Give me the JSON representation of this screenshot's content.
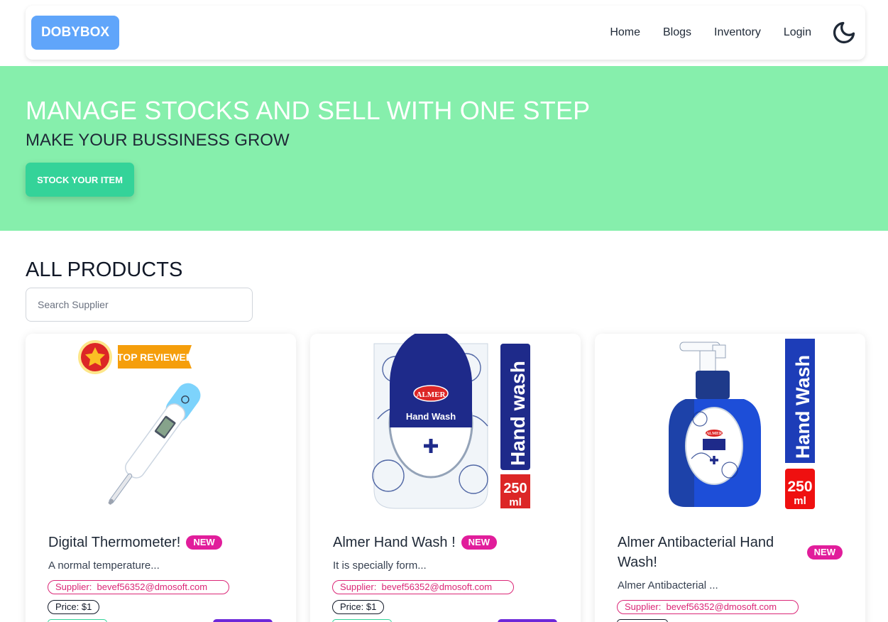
{
  "navbar": {
    "brand": "DOBYBOX",
    "links": [
      "Home",
      "Blogs",
      "Inventory",
      "Login"
    ],
    "theme_icon": "moon-icon"
  },
  "hero": {
    "headline": "MANAGE STOCKS AND SELL WITH ONE STEP",
    "subheadline": "MAKE YOUR BUSSINESS GROW",
    "cta_label": "STOCK YOUR ITEM"
  },
  "products": {
    "title": "ALL PRODUCTS",
    "search_placeholder": "Search Supplier",
    "items": [
      {
        "name": "Digital Thermometer!",
        "badge": "NEW",
        "description": "A normal temperature...",
        "supplier_label": "Supplier:",
        "supplier_email": "bevef56352@dmosoft.com",
        "price": "Price: $1",
        "ribbon": "TOP REVIEWED"
      },
      {
        "name": "Almer Hand Wash !",
        "badge": "NEW",
        "description": "It is specially form...",
        "supplier_label": "Supplier:",
        "supplier_email": "bevef56352@dmosoft.com",
        "price": "Price: $1",
        "pack_label": "Hand wash",
        "pack_brand": "ALMER",
        "pack_product": "Hand Wash",
        "pack_size": "250",
        "pack_unit": "ml"
      },
      {
        "name": "Almer Antibacterial Hand Wash!",
        "badge": "NEW",
        "description": "Almer Antibacterial ...",
        "supplier_label": "Supplier:",
        "supplier_email": "bevef56352@dmosoft.com",
        "pack_label": "Hand Wash",
        "pack_brand": "ALMER",
        "pack_size": "250",
        "pack_unit": "ml"
      }
    ]
  },
  "colors": {
    "brand": "#60a5fa",
    "hero_bg": "#86efac",
    "cta": "#34d399",
    "badge": "#e11d9b",
    "supplier": "#db2777"
  }
}
